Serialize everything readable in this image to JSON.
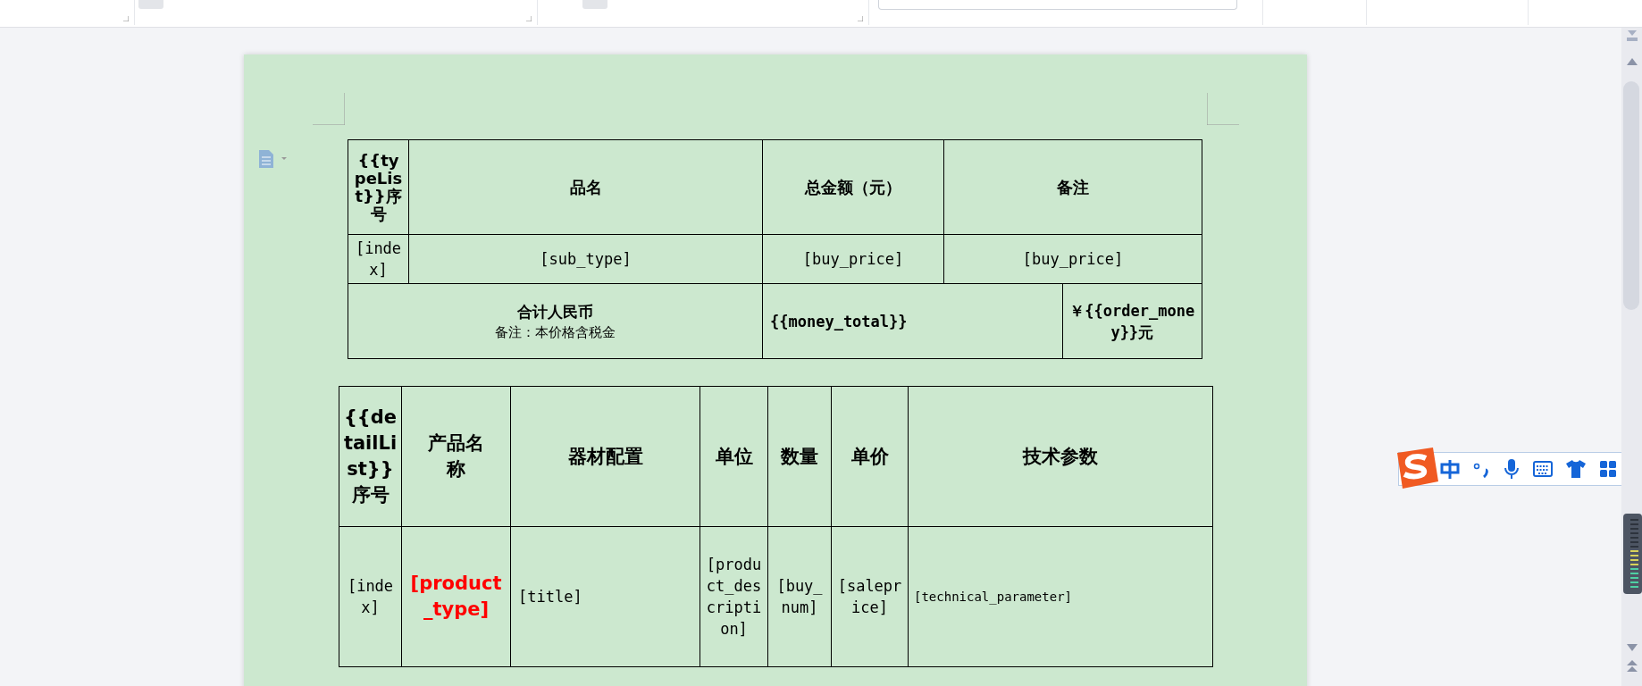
{
  "table1": {
    "header": [
      "{{typeList}}序号",
      "品名",
      "总金额（元）",
      "备注"
    ],
    "row": [
      "[index]",
      "[sub_type]",
      "[buy_price]",
      "[buy_price]"
    ],
    "total": {
      "label": "合计人民币",
      "note": "备注：本价格含税金",
      "amount": "{{money_total}}",
      "currency": "￥{{order_money}}元"
    }
  },
  "table2": {
    "header": [
      "{{detailList}}序号",
      "产品名称",
      "器材配置",
      "单位",
      "数量",
      "单价",
      "技术参数"
    ],
    "row": [
      {
        "text": "[index]",
        "color": "#000000",
        "bold": false
      },
      {
        "text": "[product_type]",
        "color": "#ff0000",
        "bold": true
      },
      {
        "text": "[title]",
        "color": "#000000",
        "bold": false
      },
      {
        "text": "[product_description]",
        "color": "#000000",
        "bold": false
      },
      {
        "text": "[buy_num]",
        "color": "#000000",
        "bold": false
      },
      {
        "text": "[saleprice]",
        "color": "#000000",
        "bold": false
      },
      {
        "text": "[technical_parameter]",
        "color": "#000000",
        "bold": false
      }
    ]
  }
}
